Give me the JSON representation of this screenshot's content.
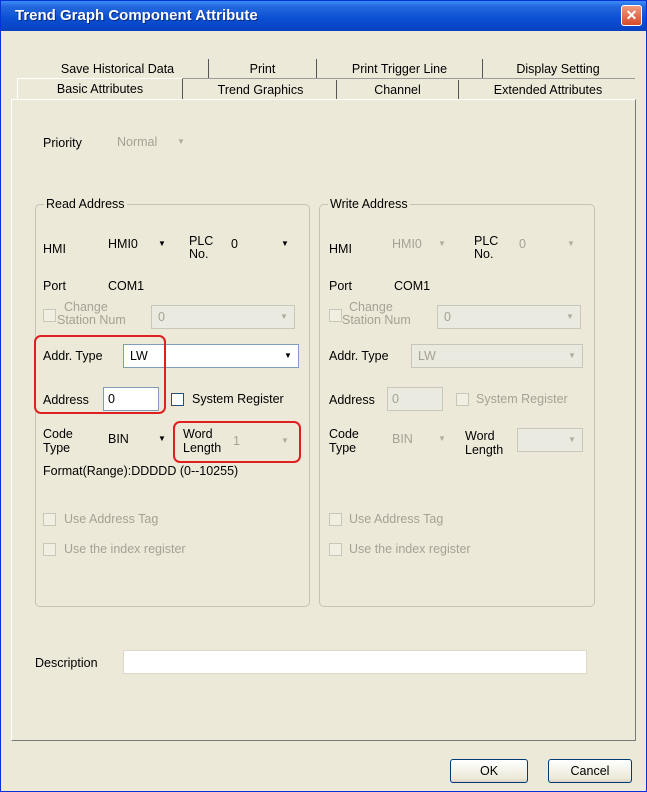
{
  "window": {
    "title": "Trend Graph Component Attribute",
    "close_glyph": "✕"
  },
  "tabs": {
    "row1": [
      "Save Historical Data",
      "Print",
      "Print Trigger Line",
      "Display Setting"
    ],
    "row2": [
      "Basic Attributes",
      "Trend Graphics",
      "Channel",
      "Extended Attributes"
    ],
    "active": "Basic Attributes"
  },
  "priority": {
    "label": "Priority",
    "value": "Normal"
  },
  "read": {
    "title": "Read Address",
    "hmi_label": "HMI",
    "hmi_value": "HMI0",
    "plc_label_1": "PLC",
    "plc_label_2": "No.",
    "plc_value": "0",
    "port_label": "Port",
    "port_value": "COM1",
    "change_label_1": "Change",
    "change_label_2": "Station Num",
    "change_value": "0",
    "addr_type_label": "Addr. Type",
    "addr_type_value": "LW",
    "address_label": "Address",
    "address_value": "0",
    "system_register_label": "System Register",
    "code_label_1": "Code",
    "code_label_2": "Type",
    "code_value": "BIN",
    "word_label_1": "Word",
    "word_label_2": "Length",
    "word_value": "1",
    "format_text": "Format(Range):DDDDD (0--10255)",
    "use_tag_label": "Use Address Tag",
    "use_index_label": "Use the index register"
  },
  "write": {
    "title": "Write Address",
    "hmi_label": "HMI",
    "hmi_value": "HMI0",
    "plc_label_1": "PLC",
    "plc_label_2": "No.",
    "plc_value": "0",
    "port_label": "Port",
    "port_value": "COM1",
    "change_label_1": "Change",
    "change_label_2": "Station Num",
    "change_value": "0",
    "addr_type_label": "Addr. Type",
    "addr_type_value": "LW",
    "address_label": "Address",
    "address_value": "0",
    "system_register_label": "System Register",
    "code_label_1": "Code",
    "code_label_2": "Type",
    "code_value": "BIN",
    "word_label_1": "Word",
    "word_label_2": "Length",
    "word_value": "",
    "use_tag_label": "Use Address Tag",
    "use_index_label": "Use the index register"
  },
  "description": {
    "label": "Description",
    "value": ""
  },
  "buttons": {
    "ok": "OK",
    "cancel": "Cancel"
  },
  "icons": {
    "dropdown": "▼"
  },
  "colors": {
    "highlight": "#e02020",
    "titlebar": "#0a4fd3"
  }
}
